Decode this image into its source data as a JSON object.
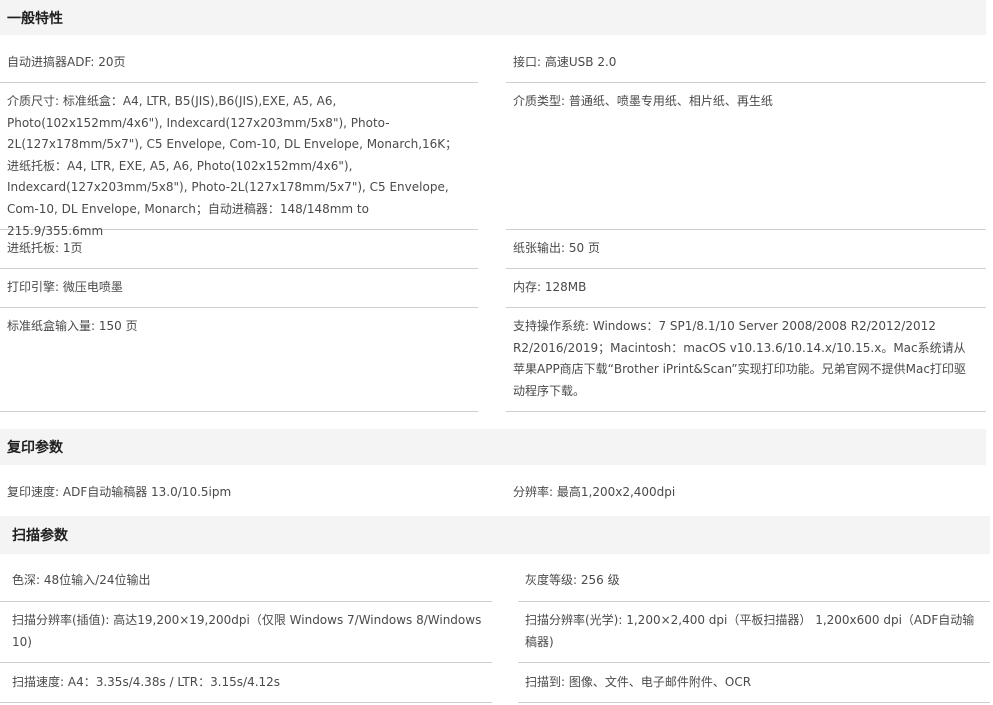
{
  "sections": [
    {
      "title": "一般特性",
      "rows": [
        {
          "left": {
            "label": "自动进搞器ADF",
            "value": "20页"
          },
          "right": {
            "label": "接口",
            "value": "高速USB 2.0"
          }
        },
        {
          "left": {
            "label": "介质尺寸",
            "value": "标准纸盒：A4, LTR, B5(JIS),B6(JIS),EXE, A5, A6, Photo(102x152mm/4x6\"), Indexcard(127x203mm/5x8\"), Photo-2L(127x178mm/5x7\"), C5 Envelope, Com-10, DL Envelope, Monarch,16K；进纸托板：A4, LTR, EXE, A5, A6, Photo(102x152mm/4x6\"), Indexcard(127x203mm/5x8\"), Photo-2L(127x178mm/5x7\"), C5 Envelope, Com-10, DL Envelope, Monarch；自动进稿器：148/148mm to 215.9/355.6mm"
          },
          "right": {
            "label": "介质类型",
            "value": "普通纸、喷墨专用纸、相片纸、再生纸"
          }
        },
        {
          "left": {
            "label": "进纸托板",
            "value": "1页"
          },
          "right": {
            "label": "纸张输出",
            "value": "50 页"
          }
        },
        {
          "left": {
            "label": "打印引擎",
            "value": "微压电喷墨"
          },
          "right": {
            "label": "内存",
            "value": "128MB"
          }
        },
        {
          "left": {
            "label": "标准纸盒输入量",
            "value": "150 页"
          },
          "right": {
            "label": "支持操作系统",
            "value": "Windows：7 SP1/8.1/10 Server 2008/2008 R2/2012/2012 R2/2016/2019；Macintosh：macOS v10.13.6/10.14.x/10.15.x。Mac系统请从苹果APP商店下载“Brother iPrint&Scan”实现打印功能。兄弟官网不提供Mac打印驱动程序下载。"
          }
        }
      ]
    },
    {
      "title": "复印参数",
      "rows": [
        {
          "left": {
            "label": "复印速度",
            "value": "ADF自动输稿器 13.0/10.5ipm"
          },
          "right": {
            "label": "分辨率",
            "value": "最高1,200x2,400dpi"
          }
        }
      ]
    },
    {
      "title": "扫描参数",
      "rows": [
        {
          "left": {
            "label": "色深",
            "value": "48位输入/24位输出"
          },
          "right": {
            "label": "灰度等级",
            "value": "256 级"
          }
        },
        {
          "left": {
            "label": "扫描分辨率(插值)",
            "value": "高达19,200×19,200dpi（仅限 Windows 7/Windows 8/Windows 10)"
          },
          "right": {
            "label": "扫描分辨率(光学)",
            "value": "1,200×2,400 dpi（平板扫描器） 1,200x600 dpi（ADF自动输稿器)"
          }
        },
        {
          "left": {
            "label": "扫描速度",
            "value": "A4：3.35s/4.38s / LTR：3.15s/4.12s"
          },
          "right": {
            "label": "扫描到",
            "value": "图像、文件、电子邮件附件、OCR"
          }
        }
      ]
    }
  ]
}
